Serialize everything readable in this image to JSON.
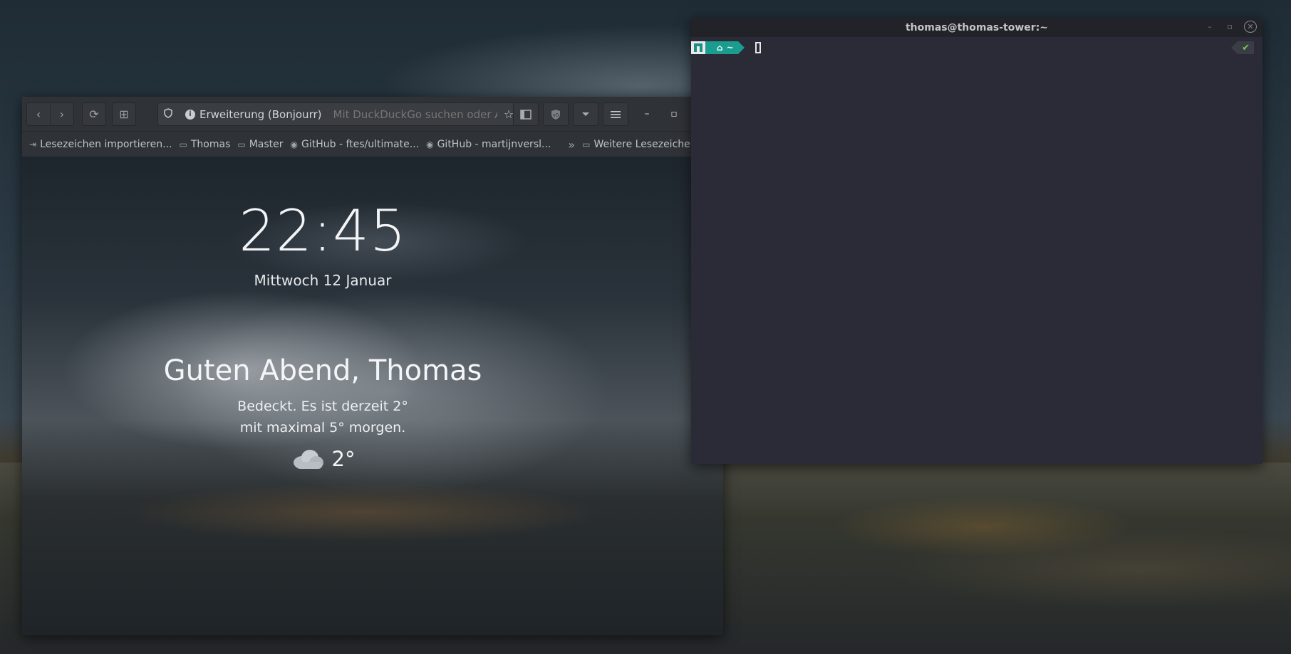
{
  "browser": {
    "toolbar": {
      "back_icon": "‹",
      "forward_icon": "›",
      "reload_icon": "⟳",
      "new_tab_icon": "⊞",
      "url_extension_label": "Erweiterung (Bonjourr)",
      "url_placeholder": "Mit DuckDuckGo suchen oder Adresse eingeben",
      "minimize_icon": "–",
      "maximize_icon": "▫"
    },
    "bookmarks": {
      "items": [
        {
          "label": "Lesezeichen importieren...",
          "icon": "import-icon"
        },
        {
          "label": "Thomas",
          "icon": "folder-icon"
        },
        {
          "label": "Master",
          "icon": "folder-icon"
        },
        {
          "label": "GitHub - ftes/ultimate...",
          "icon": "github-icon"
        },
        {
          "label": "GitHub - martijnversl...",
          "icon": "github-icon"
        }
      ],
      "more_icon": "»",
      "other_label": "Weitere Lesezeichen"
    },
    "newtab": {
      "time": "22:45",
      "date": "Mittwoch 12 Januar",
      "greeting": "Guten Abend, Thomas",
      "weather_line1": "Bedeckt. Es ist derzeit 2°",
      "weather_line2": "mit maximal 5° morgen.",
      "temperature": "2°",
      "weather_icon": "cloud-icon"
    }
  },
  "terminal": {
    "title": "thomas@thomas-tower:~",
    "prompt_dir": "~",
    "prompt_home_icon": "home-icon",
    "status_ok": "✔",
    "colors": {
      "accent": "#1a9c8e",
      "ok": "#7ac943",
      "background": "#2b2b38"
    }
  }
}
